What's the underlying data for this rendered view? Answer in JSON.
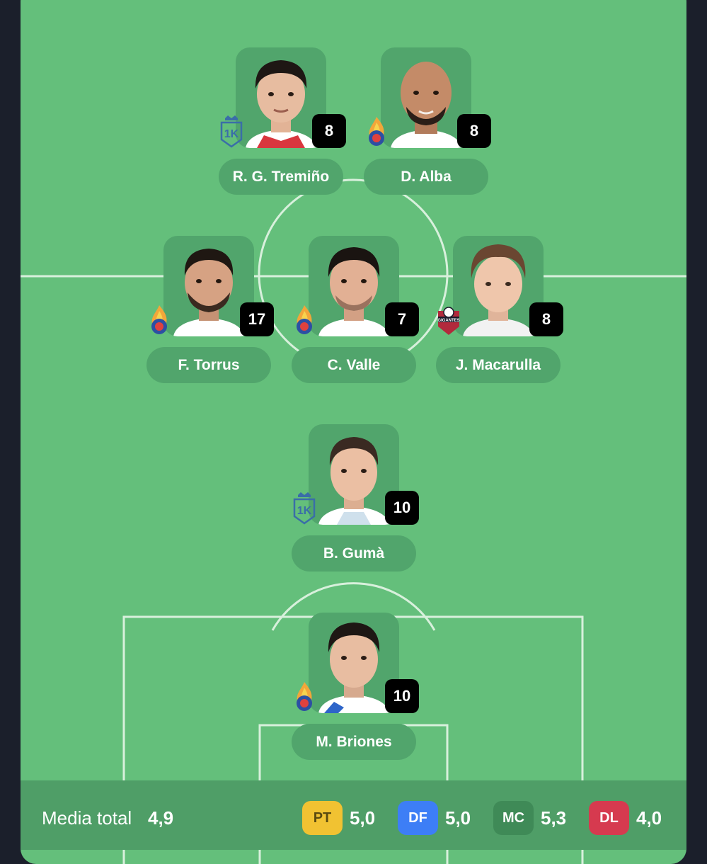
{
  "players": [
    {
      "name": "R. G. Tremiño",
      "score": "8",
      "club": "kings-league-icon",
      "hair": "dark"
    },
    {
      "name": "D. Alba",
      "score": "8",
      "club": "porcinos-fire-icon",
      "hair": "bald"
    },
    {
      "name": "F. Torrus",
      "score": "17",
      "club": "porcinos-fire-icon",
      "hair": "dark"
    },
    {
      "name": "C. Valle",
      "score": "7",
      "club": "porcinos-fire-icon",
      "hair": "dark"
    },
    {
      "name": "J. Macarulla",
      "score": "8",
      "club": "gigantes-icon",
      "hair": "brown"
    },
    {
      "name": "B. Gumà",
      "score": "10",
      "club": "kings-league-icon",
      "hair": "dark"
    },
    {
      "name": "M. Briones",
      "score": "10",
      "club": "porcinos-fire-icon",
      "hair": "dark"
    }
  ],
  "gigantes_badge_text": "GIGANTES",
  "footer": {
    "total_label": "Media total",
    "total_value": "4,9",
    "positions": [
      {
        "code": "PT",
        "value": "5,0",
        "color": "#f1c232",
        "text_color": "#5a4a10"
      },
      {
        "code": "DF",
        "value": "5,0",
        "color": "#3d7ef6",
        "text_color": "#ffffff"
      },
      {
        "code": "MC",
        "value": "5,3",
        "color": "#3f8a57",
        "text_color": "#ffffff"
      },
      {
        "code": "DL",
        "value": "4,0",
        "color": "#d63a4f",
        "text_color": "#ffffff"
      }
    ]
  },
  "colors": {
    "pitch": "#64bf7b",
    "card": "#51a56c",
    "background": "#1b1f2b"
  }
}
